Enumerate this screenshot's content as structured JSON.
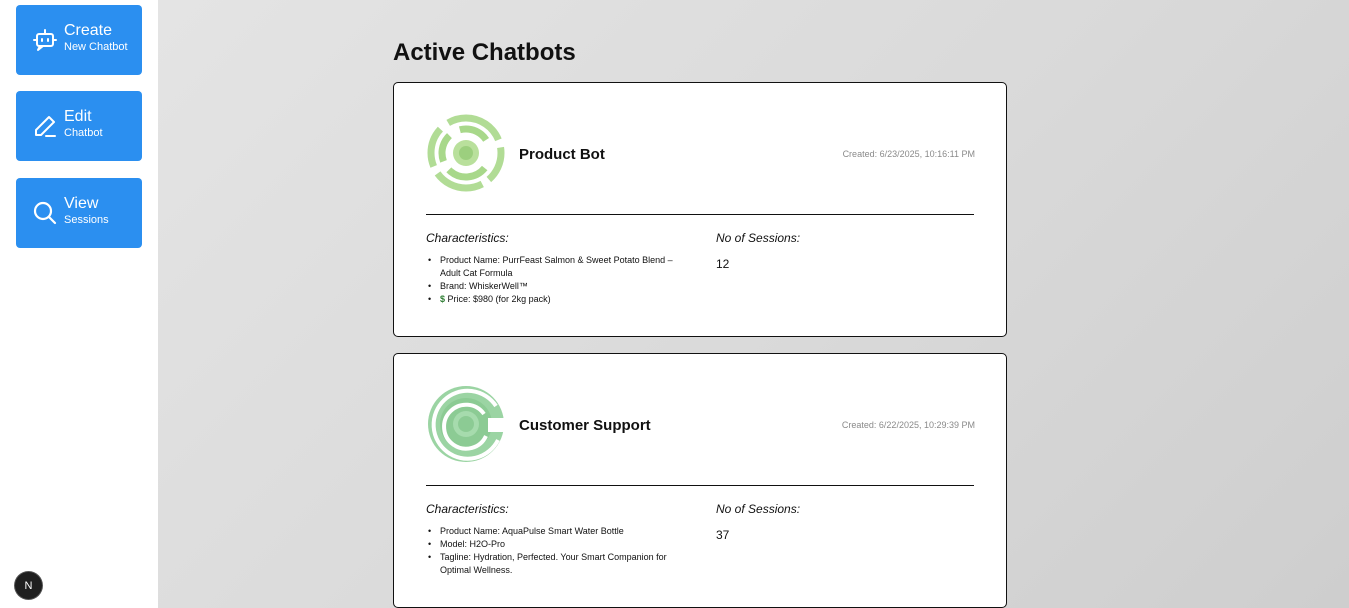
{
  "sidebar": {
    "buttons": [
      {
        "title": "Create",
        "subtitle": "New Chatbot",
        "icon": "bot-icon"
      },
      {
        "title": "Edit",
        "subtitle": "Chatbot",
        "icon": "pencil-icon"
      },
      {
        "title": "View",
        "subtitle": "Sessions",
        "icon": "search-icon"
      }
    ],
    "badge": "N"
  },
  "main": {
    "title": "Active Chatbots",
    "characteristics_label": "Characteristics:",
    "sessions_label": "No of Sessions:",
    "cards": [
      {
        "name": "Product Bot",
        "created": "Created: 6/23/2025, 10:16:11 PM",
        "characteristics": [
          "Product Name: PurrFeast Salmon & Sweet Potato Blend – Adult Cat Formula",
          "Brand: WhiskerWell™",
          "Price: $980 (for 2kg pack)"
        ],
        "money_icon": "$",
        "sessions": "12",
        "logo_color": "#a8d88a"
      },
      {
        "name": "Customer Support",
        "created": "Created: 6/22/2025, 10:29:39 PM",
        "characteristics": [
          "Product Name: AquaPulse Smart Water Bottle",
          "Model: H2O-Pro",
          "Tagline: Hydration, Perfected. Your Smart Companion for Optimal Wellness."
        ],
        "sessions": "37",
        "logo_color": "#8fd19a"
      }
    ]
  },
  "colors": {
    "accent": "#2b8ff0",
    "background": "#d9d9d9"
  }
}
